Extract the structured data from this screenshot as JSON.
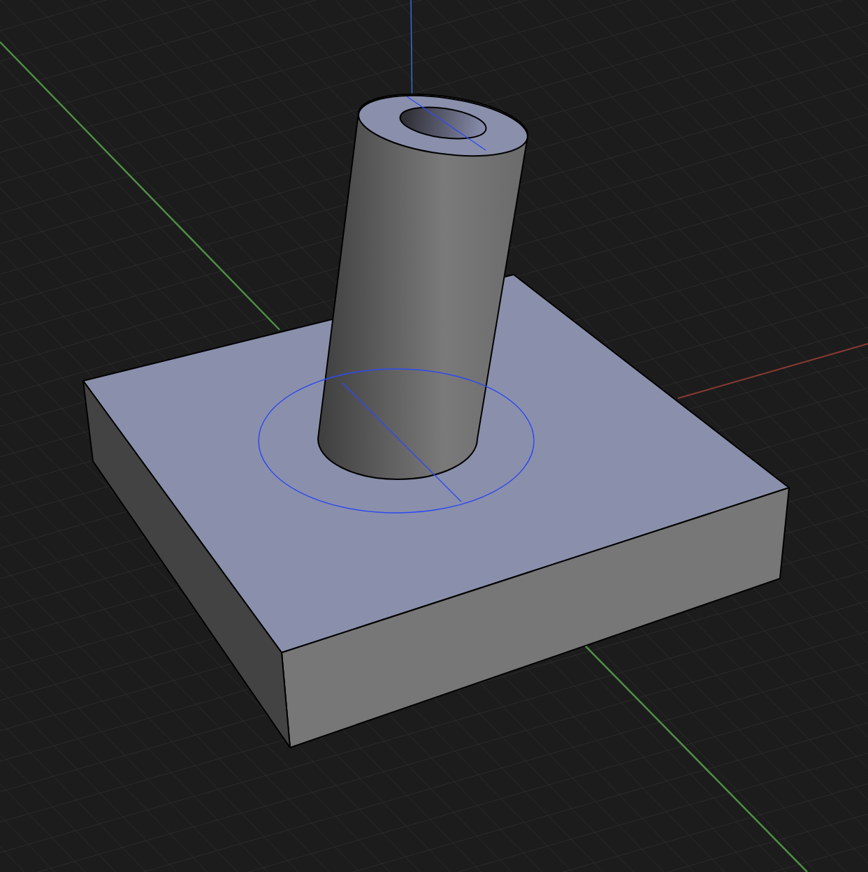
{
  "viewport": {
    "grid_visible": true,
    "axes_visible": true,
    "sketch_visible": true
  }
}
